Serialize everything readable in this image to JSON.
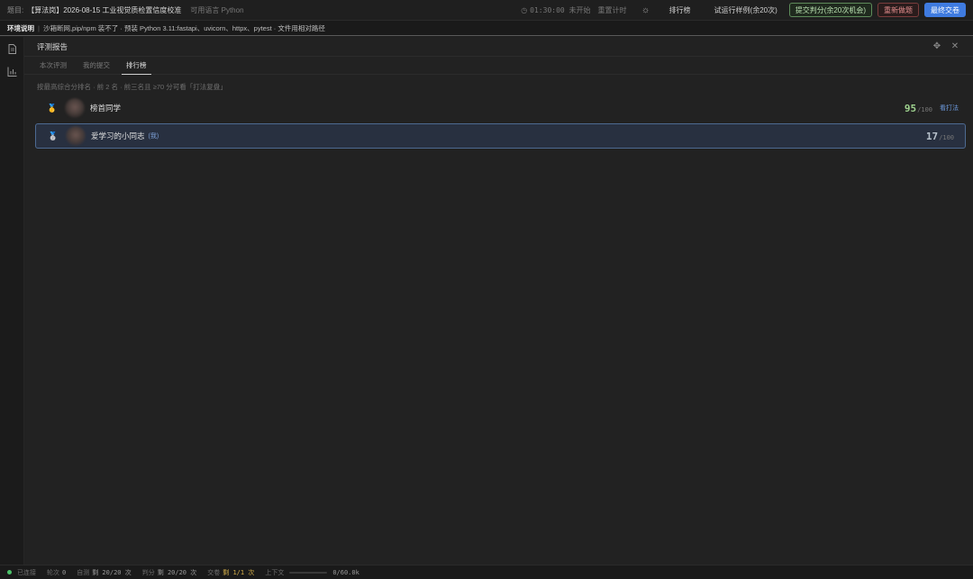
{
  "topbar": {
    "question_label": "题目:",
    "question_title": "【算法岗】2026-08-15 工业视觉质检置信度校准",
    "language": "可用语言 Python",
    "timer": "01:30:00 未开始",
    "reset_timer": "重置计时",
    "buttons": {
      "leaderboard": "排行榜",
      "trial_run": "试运行样例(余20次)",
      "submit_score": "提交判分(余20次机会)",
      "redo": "重新做题",
      "final_submit": "最终交卷"
    }
  },
  "env": {
    "title": "环境说明",
    "separator": "|",
    "text": "沙箱断网,pip/npm 装不了 · 预装 Python 3.11:fastapi、uvicorn、httpx、pytest · 文件用相对路径"
  },
  "panel": {
    "title": "评测报告",
    "tabs": [
      {
        "label": "本次评测",
        "active": false
      },
      {
        "label": "我的提交",
        "active": false
      },
      {
        "label": "排行榜",
        "active": true
      }
    ],
    "rank_note": "按最高综合分排名 · 前 2 名 · 前三名且 ≥70 分可看「打法复盘」",
    "leaderboard": [
      {
        "medal": "🥇",
        "name": "榜首同学",
        "me_tag": "",
        "score": "95",
        "total": "/100",
        "link": "看打法"
      },
      {
        "medal": "🥈",
        "name": "爱学习的小同志",
        "me_tag": "(我)",
        "score": "17",
        "total": "/100",
        "link": ""
      }
    ]
  },
  "statusbar": {
    "connected": "已连接",
    "rounds_label": "轮次",
    "rounds_value": "0",
    "self_test_label": "自测",
    "self_test_value": "剩 20/20 次",
    "score_label": "判分",
    "score_value": "剩 20/20 次",
    "submit_label": "交卷",
    "submit_value": "剩 1/1 次",
    "context_label": "上下文",
    "context_value": "0/60.0k",
    "context_fraction": 0
  },
  "colors": {
    "accent_blue": "#3f7be0",
    "score_green": "#9fd38f",
    "connected_green": "#4cc26a",
    "highlight_border": "#4d6a92"
  }
}
